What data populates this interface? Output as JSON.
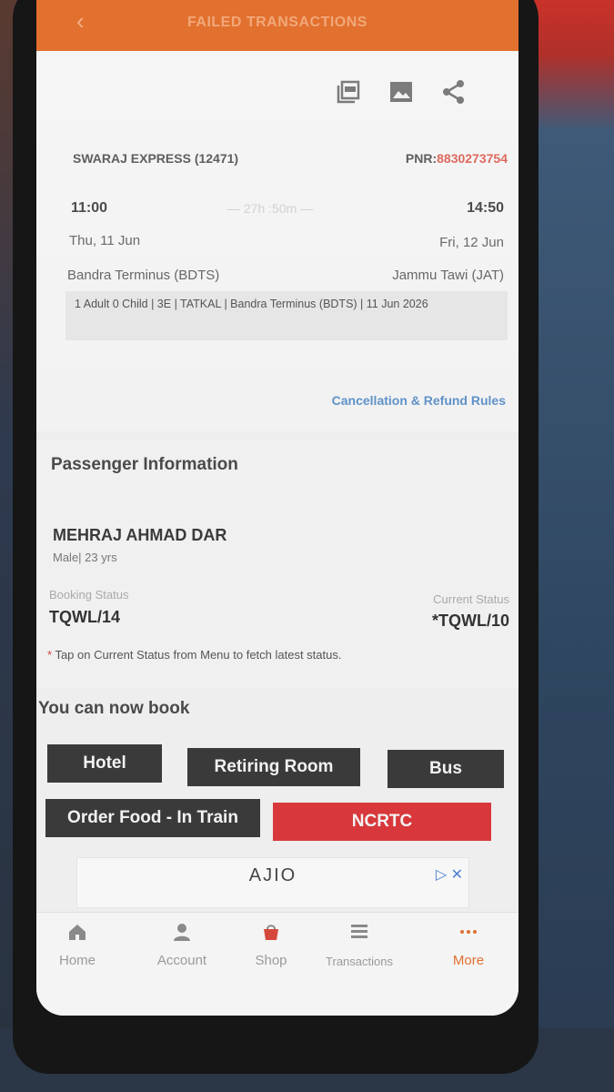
{
  "appbar": {
    "title": "FAILED TRANSACTIONS",
    "back_icon": "back-arrow-icon"
  },
  "toolbar_icons": [
    "pdf-icon",
    "image-icon",
    "share-icon"
  ],
  "journey": {
    "train": "SWARAJ EXPRESS (12471)",
    "pnr_label": "PNR:",
    "pnr_value": "8830273754",
    "departure_time": "11:00",
    "arrival_time": "14:50",
    "duration": "— 27h :50m —",
    "departure_date": "Thu, 11 Jun",
    "arrival_date": "Fri, 12 Jun",
    "from_station": "Bandra Terminus (BDTS)",
    "to_station": "Jammu Tawi (JAT)",
    "summary": "1 Adult 0 Child  | 3E | TATKAL | Bandra Terminus (BDTS) | 11 Jun 2026",
    "refund_link": "Cancellation & Refund Rules"
  },
  "passenger": {
    "section_title": "Passenger Information",
    "name": "MEHRAJ AHMAD DAR",
    "meta": "Male| 23 yrs",
    "booking_status_label": "Booking Status",
    "booking_status": "TQWL/14",
    "current_status_label": "Current Status",
    "current_status": "*TQWL/10",
    "note_star": "*",
    "note": " Tap on Current Status from Menu to fetch latest status."
  },
  "book": {
    "title": "You can now book",
    "hotel": "Hotel",
    "retiring_room": "Retiring Room",
    "bus": "Bus",
    "order_food": "Order Food - In Train",
    "ncrtc": "NCRTC"
  },
  "ad": {
    "logo": "AJIO",
    "choices": "▷ ✕"
  },
  "nav": {
    "home": "Home",
    "account": "Account",
    "shop": "Shop",
    "transactions": "Transactions",
    "more": "More"
  },
  "colors": {
    "appbar": "#e2702f",
    "accent_red": "#d8383b",
    "button_dark": "#3a3a3a",
    "link_blue": "#5c8fc7"
  }
}
